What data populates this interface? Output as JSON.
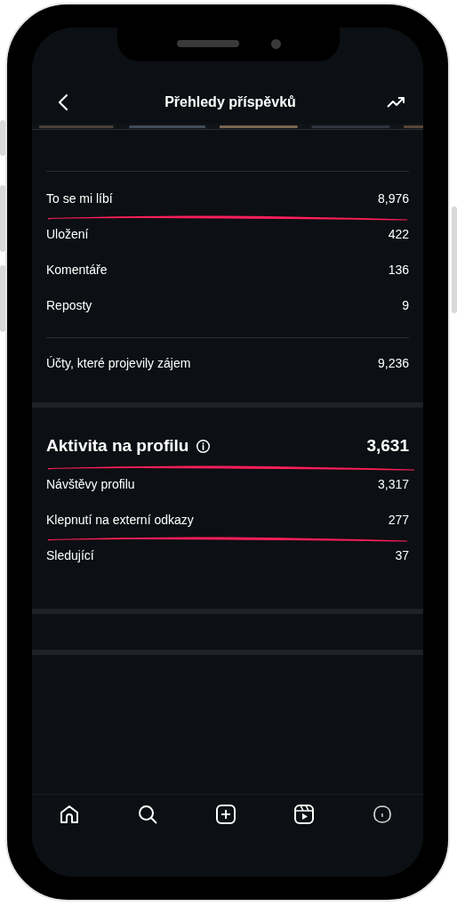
{
  "header": {
    "title": "Přehledy příspěvků"
  },
  "interactions": [
    {
      "label": "To se mi líbí",
      "value": "8,976",
      "highlighted": true
    },
    {
      "label": "Uložení",
      "value": "422",
      "highlighted": false
    },
    {
      "label": "Komentáře",
      "value": "136",
      "highlighted": false
    },
    {
      "label": "Reposty",
      "value": "9",
      "highlighted": false
    }
  ],
  "accounts_engaged": {
    "label": "Účty, které projevily zájem",
    "value": "9,236",
    "highlighted": false
  },
  "profile_activity": {
    "title": "Aktivita na profilu",
    "value": "3,631",
    "highlighted": true,
    "rows": [
      {
        "label": "Návštěvy profilu",
        "value": "3,317",
        "highlighted": false
      },
      {
        "label": "Klepnutí na externí odkazy",
        "value": "277",
        "highlighted": true
      },
      {
        "label": "Sledující",
        "value": "37",
        "highlighted": false
      }
    ]
  },
  "bottom_nav": [
    {
      "kind": "home"
    },
    {
      "kind": "search"
    },
    {
      "kind": "create"
    },
    {
      "kind": "reels"
    },
    {
      "kind": "profile"
    }
  ]
}
